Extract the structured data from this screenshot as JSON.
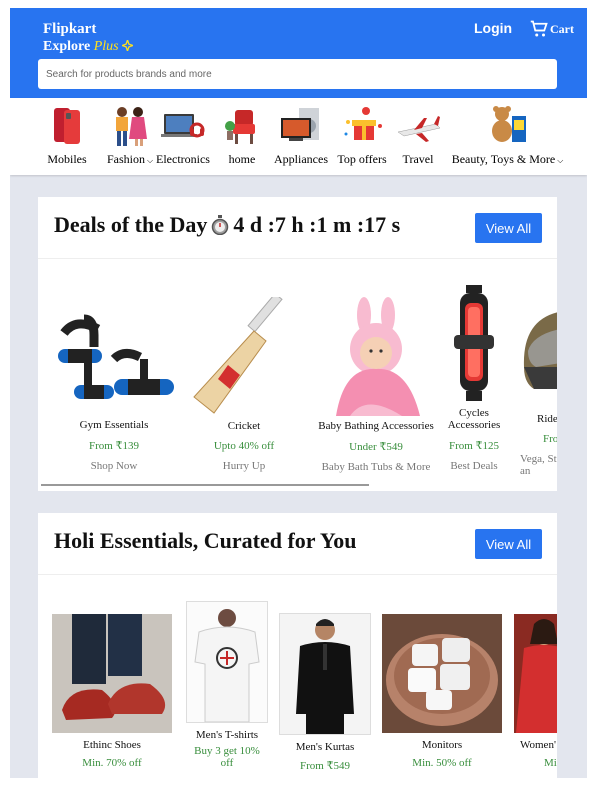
{
  "header": {
    "brand": "Flipkart",
    "explore": "Explore",
    "plus": "Plus",
    "login_label": "Login",
    "cart_label": "Cart",
    "search_placeholder": "Search for products brands and more"
  },
  "categories": [
    {
      "label": "Mobiles",
      "icon": "mobiles-image"
    },
    {
      "label": "Fashion",
      "icon": "fashion-image",
      "dropdown": true
    },
    {
      "label": "Electronics",
      "icon": "electronics-image"
    },
    {
      "label": "home",
      "icon": "home-image"
    },
    {
      "label": "Appliances",
      "icon": "appliances-image"
    },
    {
      "label": "Top offers",
      "icon": "top-offers-image"
    },
    {
      "label": "Travel",
      "icon": "travel-image"
    },
    {
      "label": "Beauty, Toys & More",
      "icon": "beauty-toys-image",
      "dropdown": true
    }
  ],
  "deals": {
    "title": "Deals of the Day",
    "timer": "4 d :7 h :1 m :17 s",
    "view_all": "View All",
    "products": [
      {
        "name": "Gym Essentials",
        "price": "From ₹139",
        "sub": "Shop Now"
      },
      {
        "name": "Cricket",
        "price": "Upto 40% off",
        "sub": "Hurry Up"
      },
      {
        "name": "Baby Bathing Accessories",
        "price": "Under ₹549",
        "sub": "Baby Bath Tubs & More"
      },
      {
        "name": "Cycles Accessories",
        "price": "From ₹125",
        "sub": "Best Deals"
      },
      {
        "name": "Ride",
        "price": "Fro",
        "sub": "Vega, St an"
      }
    ]
  },
  "holi": {
    "title": "Holi Essentials, Curated for You",
    "view_all": "View All",
    "products": [
      {
        "name": "Ethinc Shoes",
        "price": "Min. 70% off"
      },
      {
        "name": "Men's T-shirts",
        "price": "Buy 3 get 10% off"
      },
      {
        "name": "Men's Kurtas",
        "price": "From ₹549"
      },
      {
        "name": "Monitors",
        "price": "Min. 50% off"
      },
      {
        "name": "Women'",
        "price": "Mi"
      }
    ]
  },
  "colors": {
    "brand_blue": "#2874f0",
    "plus_yellow": "#ffe11b",
    "price_green": "#388e3c",
    "page_bg": "#e3e6ee"
  }
}
